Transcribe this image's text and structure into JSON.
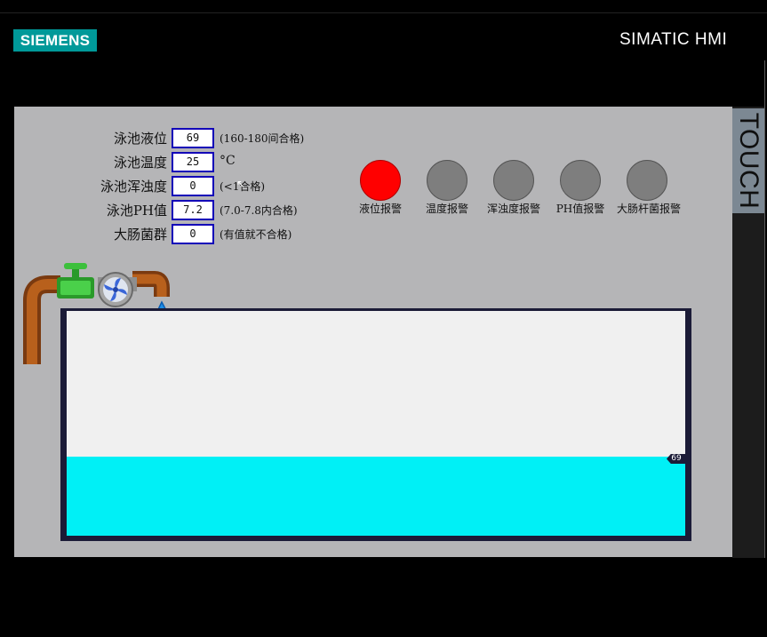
{
  "brand": {
    "logo": "SIEMENS",
    "product": "SIMATIC HMI",
    "side_label": "TOUCH"
  },
  "params": [
    {
      "label": "泳池液位",
      "value": "69",
      "note": "(160-180间合格)"
    },
    {
      "label": "泳池温度",
      "value": "25",
      "note": "°C"
    },
    {
      "label": "泳池浑浊度",
      "value": "0",
      "note": "(<1合格)"
    },
    {
      "label": "泳池PH值",
      "value": "7.2",
      "note": "(7.0-7.8内合格)"
    },
    {
      "label": "大肠菌群",
      "value": "0",
      "note": "(有值就不合格)"
    }
  ],
  "alarms": [
    {
      "label": "液位报警",
      "active": true
    },
    {
      "label": "温度报警",
      "active": false
    },
    {
      "label": "浑浊度报警",
      "active": false
    },
    {
      "label": "PH值报警",
      "active": false
    },
    {
      "label": "大肠杆菌报警",
      "active": false
    }
  ],
  "tank": {
    "level_label": "69",
    "fill_fraction": 0.35
  },
  "colors": {
    "screen_bg": "#b5b5b7",
    "alarm_on": "#ff0000",
    "alarm_off": "#7e7e7e",
    "water": "#00f0f6",
    "field_border": "#1200b8",
    "logo_bg": "#009999"
  },
  "icons": [
    "pipe-icon",
    "valve-icon",
    "pump-fan-icon",
    "water-drop-icon",
    "mouse-cursor-icon"
  ]
}
